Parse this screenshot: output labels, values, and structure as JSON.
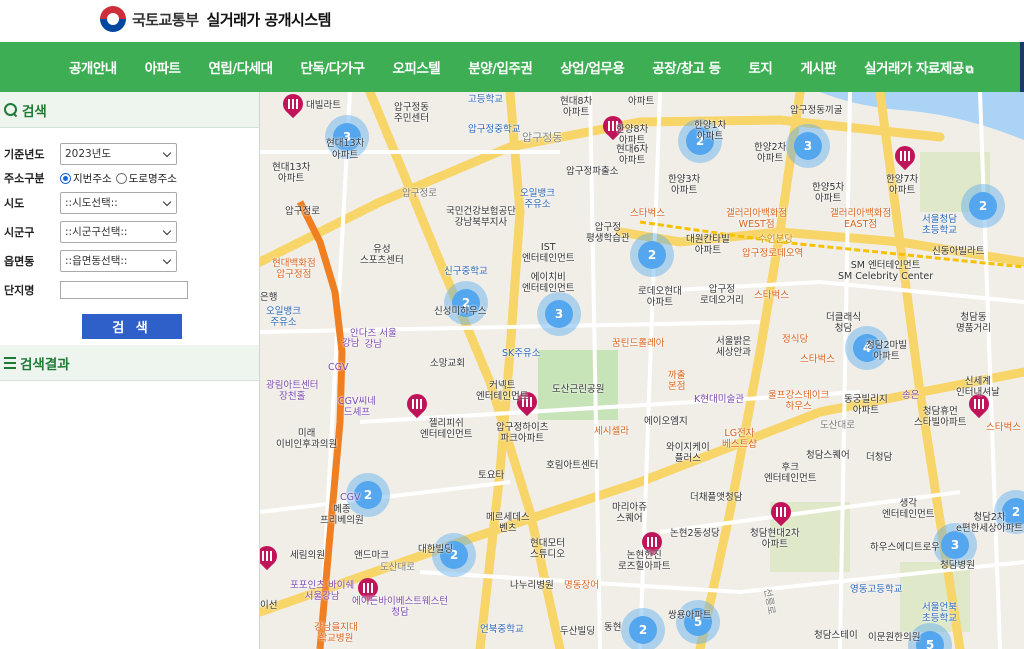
{
  "header": {
    "ministry": "국토교통부",
    "system": "실거래가 공개시스템"
  },
  "nav": [
    "공개안내",
    "아파트",
    "연립/다세대",
    "단독/다가구",
    "오피스텔",
    "분양/입주권",
    "상업/업무용",
    "공장/창고 등",
    "토지",
    "게시판",
    "실거래가 자료제공"
  ],
  "search": {
    "title": "검색",
    "base_year_label": "기준년도",
    "base_year_value": "2023년도",
    "address_type_label": "주소구분",
    "address_opt_lot": "지번주소",
    "address_opt_road": "도로명주소",
    "sido_label": "시도",
    "sido_value": "::시도선택::",
    "sigungu_label": "시군구",
    "sigungu_value": "::시군구선택::",
    "eupmyeondong_label": "읍면동",
    "eupmyeondong_value": "::읍면동선택::",
    "complex_label": "단지명",
    "complex_value": "",
    "button": "검 색"
  },
  "results": {
    "title": "검색결과"
  },
  "map": {
    "clusters": [
      "3",
      "2",
      "3",
      "2",
      "2",
      "2",
      "3",
      "4",
      "2",
      "2",
      "3",
      "2",
      "2",
      "5",
      "5",
      "2"
    ],
    "labels": {
      "l01": "대빌라트",
      "l02": "압구정동\n주민센터",
      "l03": "고등학교",
      "l04": "현대8차\n아파트",
      "l05": "한양8차\n아파트",
      "l06": "압구정중학교",
      "l07": "압구정동",
      "l08": "압구정파출소",
      "l09": "압구정동끼굴",
      "l10": "현대13차\n아파트",
      "l11": "압구정로",
      "l12": "국민건강보험공단\n강남북부지사",
      "l13": "오일뱅크\n주유소",
      "l14": "스타벅스",
      "l15": "압구정\n평생학습관",
      "l16": "갤러리아백화점\nWEST점",
      "l17": "갤러리아백화점\nEAST점",
      "l18": "서울청담\n초등학교",
      "l19": "IST\n엔터테인먼트",
      "l20": "신구중학교",
      "l21": "유성\n스포츠센터",
      "l22": "대원칸타빌\n아파트",
      "l23": "SM 엔터테인먼트\nSM Celebrity Center",
      "l24": "신동아빌라트",
      "l25": "현대백화점\n압구정점",
      "l26": "수인분당",
      "l27": "압구정로데오역",
      "l28": "에이치비\n엔터테인먼트",
      "l29": "로데오현대\n아파트",
      "l30": "압구정\n로데오거리",
      "l31": "스타벅스",
      "l32": "오일뱅크\n주유소",
      "l33": "신성미하우스",
      "l34": "안다즈 서울\n강남",
      "l35": "더클래식\n청담",
      "l36": "청담동\n명품거리",
      "l37": "SK주유소",
      "l38": "꿈틴드롤레아",
      "l39": "서울밝은\n세상안과",
      "l40": "정식당",
      "l41": "스타벅스",
      "l42": "소망교회",
      "l43": "CGV",
      "l44": "커넥트\n엔터테인먼트",
      "l45": "도산근린공원",
      "l46": "까출\n본점",
      "l47": "K현대미술관",
      "l48": "울프강스테이크\n하우스",
      "l49": "동궁빌리지\n아파트",
      "l50": "송은",
      "l51": "신세계\n인터내셔날",
      "l52": "광림아트센터\n장천홀",
      "l53": "CGV씨네\n드셰프",
      "l54": "청담휴먼\n스타빌아파트",
      "l55": "미래\n이비인후과의원",
      "l56": "젤리피쉬\n엔터테인먼트",
      "l57": "압구정하이츠\n파크아파트",
      "l58": "세시셀라",
      "l59": "에이오엠지",
      "l60": "LG전자\n베스트샵",
      "l61": "도산대로",
      "l62": "스타벅스",
      "l63": "토요타",
      "l64": "호림아트센터",
      "l65": "와이지케이\n플러스",
      "l66": "청담스퀘어",
      "l67": "더청담",
      "l68": "후크\n엔터테인먼트",
      "l69": "더채플앳청담",
      "l70": "메종\n프리베의원",
      "l71": "메르세데스\n벤츠",
      "l72": "마리아쥬\n스퀘어",
      "l73": "생각\n엔터테인먼트",
      "l74": "청담2차\ne편한세상아파트",
      "l75": "논현2동성당",
      "l76": "청담현대2차\n아파트",
      "l77": "하우스에디트로우",
      "l78": "청담병원",
      "l79": "세림의원",
      "l80": "앤드마크",
      "l81": "대한빌딩",
      "l82": "현대모터\n스튜디오",
      "l83": "논현한진\n로즈힐아파트",
      "l84": "영동고등학교",
      "l85": "포포인츠 바이쉐\n서울강남",
      "l86": "에이든바이베스트웨스턴\n청담",
      "l87": "나누리병원",
      "l88": "명동장어",
      "l89": "서울언북\n초등학교",
      "l90": "강남을지대\n학교병원",
      "l91": "언북중학교",
      "l92": "두산빌딩",
      "l93": "동현",
      "l94": "쌍용아파트",
      "l95": "청담스테이",
      "l96": "이문원한의원",
      "l97": "압구정로",
      "l98": "CGV",
      "l99": "은행",
      "l100": "한양1차\n아파트",
      "l101": "한양2차\n아파트",
      "l102": "한양3차\n아파트",
      "l103": "한양5차\n아파트",
      "l104": "한양7차\n아파트",
      "l105": "현대6차\n아파트",
      "l106": "청담2마빌\n아파트",
      "l107": "아파트",
      "l108": "현대13차",
      "l109": "아파트",
      "l110": "도산대로",
      "l111": "강남",
      "l112": "선릉로",
      "l113": "이선"
    }
  }
}
